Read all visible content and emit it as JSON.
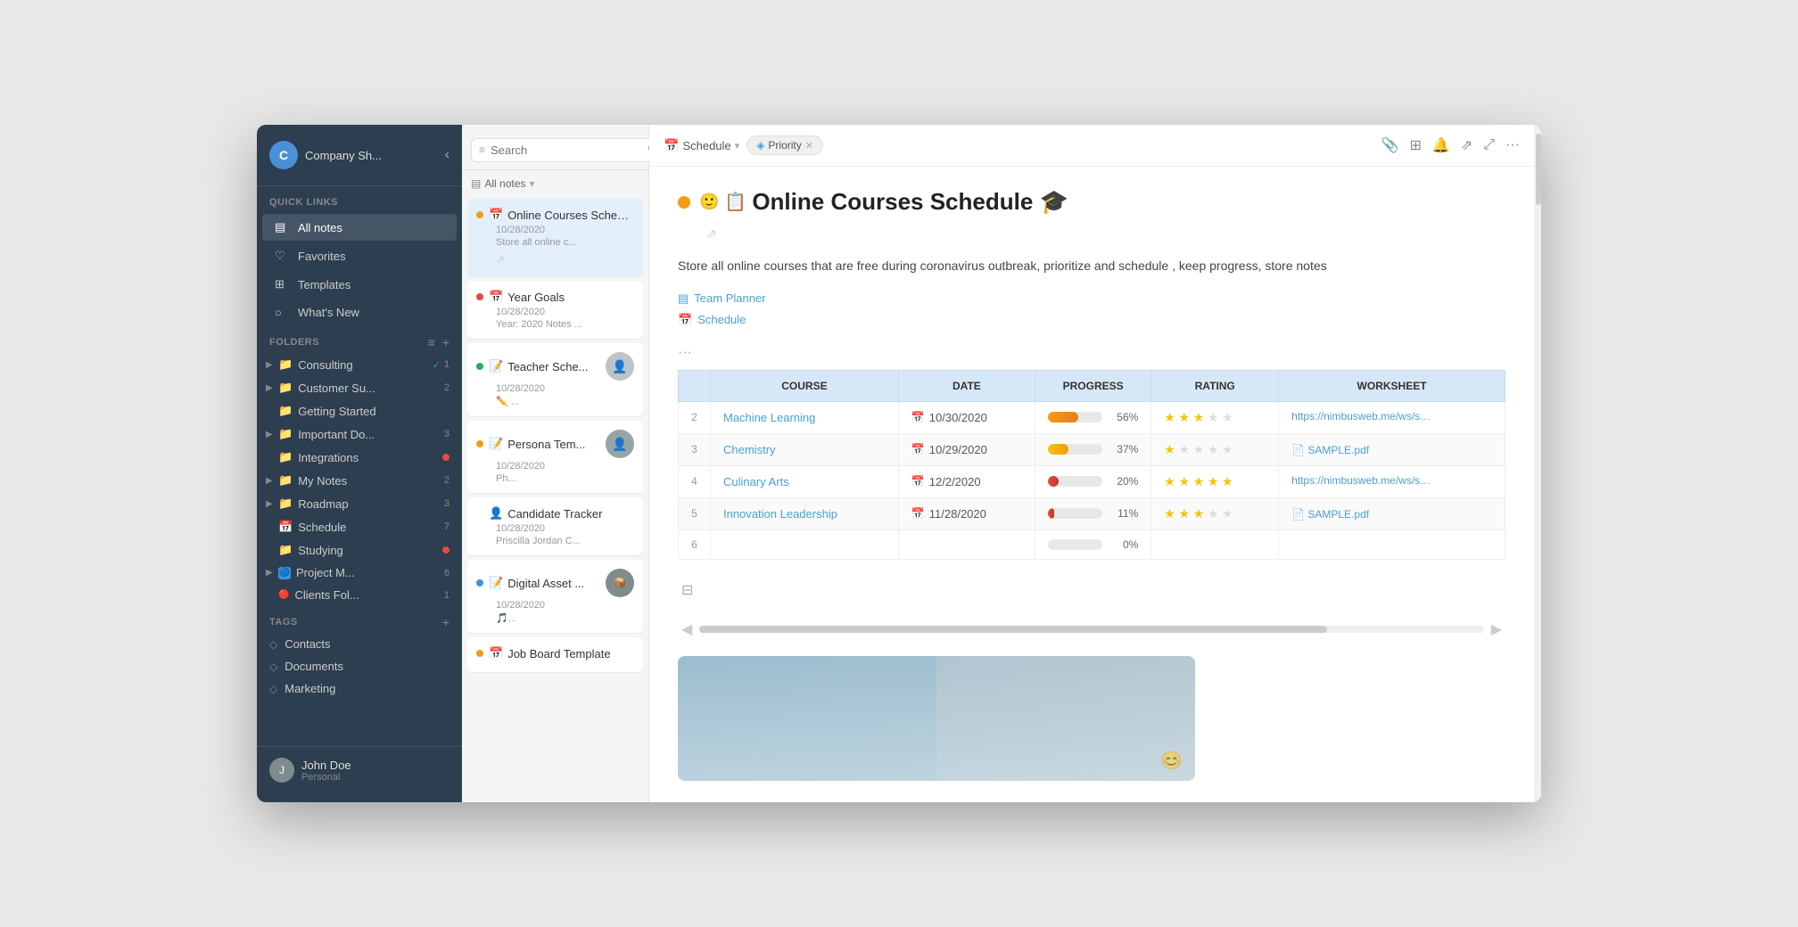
{
  "sidebar": {
    "company": "Company Sh...",
    "avatar_letter": "C",
    "quick_links_label": "Quick Links",
    "quick_links": [
      {
        "id": "all-notes",
        "icon": "▤",
        "label": "All notes",
        "active": true
      },
      {
        "id": "favorites",
        "icon": "♡",
        "label": "Favorites"
      },
      {
        "id": "templates",
        "icon": "⊞",
        "label": "Templates"
      },
      {
        "id": "whats-new",
        "icon": "○",
        "label": "What's New"
      }
    ],
    "folders_label": "Folders",
    "folders": [
      {
        "id": "consulting",
        "icon": "📁",
        "label": "Consulting",
        "badge": "✓",
        "count": "1",
        "color": "none"
      },
      {
        "id": "customer-su",
        "icon": "📁",
        "label": "Customer Su...",
        "count": "2",
        "color": "none"
      },
      {
        "id": "getting-started",
        "icon": "📁",
        "label": "Getting Started",
        "count": "",
        "color": "none"
      },
      {
        "id": "important-do",
        "icon": "📁",
        "label": "Important Do...",
        "count": "3",
        "color": "none"
      },
      {
        "id": "integrations",
        "icon": "📁",
        "label": "Integrations",
        "count": "",
        "badge_red": true
      },
      {
        "id": "my-notes",
        "icon": "📁",
        "label": "My Notes",
        "count": "2",
        "color": "none"
      },
      {
        "id": "roadmap",
        "icon": "📁",
        "label": "Roadmap",
        "count": "3",
        "color": "none"
      },
      {
        "id": "schedule",
        "icon": "📅",
        "label": "Schedule",
        "count": "7",
        "color": "none"
      },
      {
        "id": "studying",
        "icon": "📁",
        "label": "Studying",
        "badge_red": true
      },
      {
        "id": "project-m",
        "icon": "🔵",
        "label": "Project M...",
        "count": "6"
      },
      {
        "id": "clients-fol",
        "icon": "🔴",
        "label": "Clients Fol...",
        "count": "1"
      }
    ],
    "tags_label": "Tags",
    "tags": [
      {
        "id": "contacts",
        "label": "Contacts"
      },
      {
        "id": "documents",
        "label": "Documents"
      },
      {
        "id": "marketing",
        "label": "Marketing"
      }
    ],
    "user_name": "John Doe",
    "user_role": "Personal",
    "user_avatar": "J"
  },
  "notes_panel": {
    "search_placeholder": "Search",
    "all_notes_label": "All notes",
    "notes": [
      {
        "id": "online-courses",
        "dot": "orange",
        "icon": "📅",
        "title": "Online Courses Schedu...",
        "date": "10/28/2020",
        "preview": "Store all online c...",
        "selected": true,
        "has_share": true
      },
      {
        "id": "year-goals",
        "dot": "red",
        "icon": "📅",
        "title": "Year Goals",
        "date": "10/28/2020",
        "preview": "Year: 2020 Notes ...",
        "selected": false
      },
      {
        "id": "teacher-sche",
        "dot": "green",
        "icon": "📝",
        "title": "Teacher Sche...",
        "date": "10/28/2020",
        "preview": "🖊 ...",
        "has_avatar": true,
        "selected": false
      },
      {
        "id": "persona-tem",
        "dot": "orange",
        "icon": "📝",
        "title": "Persona Tem...",
        "date": "10/28/2020",
        "preview": "Ph...",
        "has_avatar": true,
        "selected": false
      },
      {
        "id": "candidate-tracker",
        "dot": "none",
        "icon": "👤",
        "title": "Candidate Tracker",
        "date": "10/28/2020",
        "preview": "Priscilla Jordan C...",
        "selected": false
      },
      {
        "id": "digital-asset",
        "dot": "blue",
        "icon": "📝",
        "title": "Digital Asset ...",
        "date": "10/28/2020",
        "preview": "🎵...",
        "has_avatar": true,
        "selected": false
      },
      {
        "id": "job-board-template",
        "dot": "orange",
        "icon": "📅",
        "title": "Job Board Template",
        "date": "",
        "preview": "",
        "selected": false
      }
    ]
  },
  "main": {
    "breadcrumb_icon": "📅",
    "breadcrumb_label": "Schedule",
    "priority_label": "Priority",
    "note_title": "Online Courses Schedule 🎓",
    "note_description": "Store all online courses that are free during coronavirus outbreak, prioritize and schedule , keep\nprogress, store notes",
    "link1_label": "Team Planner",
    "link1_icon": "▤",
    "link2_label": "Schedule",
    "link2_icon": "📅",
    "table": {
      "headers": [
        "COURSE",
        "DATE",
        "PROGRESS",
        "RATING",
        "WORKSHEET"
      ],
      "rows": [
        {
          "num": "2",
          "course": "Machine Learning",
          "date": "10/30/2020",
          "progress": 56,
          "progress_color": "orange",
          "rating": 3,
          "worksheet": "https://nimbusweb.me/ws/sq5f...",
          "worksheet_type": "url"
        },
        {
          "num": "3",
          "course": "Chemistry",
          "date": "10/29/2020",
          "progress": 37,
          "progress_color": "yellow",
          "rating": 1,
          "worksheet": "SAMPLE.pdf",
          "worksheet_type": "file"
        },
        {
          "num": "4",
          "course": "Culinary Arts",
          "date": "12/2/2020",
          "progress": 20,
          "progress_color": "red",
          "rating": 5,
          "worksheet": "https://nimbusweb.me/ws/sq5f...",
          "worksheet_type": "url"
        },
        {
          "num": "5",
          "course": "Innovation Leadership",
          "date": "11/28/2020",
          "progress": 11,
          "progress_color": "red",
          "rating": 3,
          "worksheet": "SAMPLE.pdf",
          "worksheet_type": "file"
        },
        {
          "num": "6",
          "course": "",
          "date": "",
          "progress": 0,
          "progress_color": "none",
          "rating": 0,
          "worksheet": "",
          "worksheet_type": ""
        }
      ]
    }
  }
}
